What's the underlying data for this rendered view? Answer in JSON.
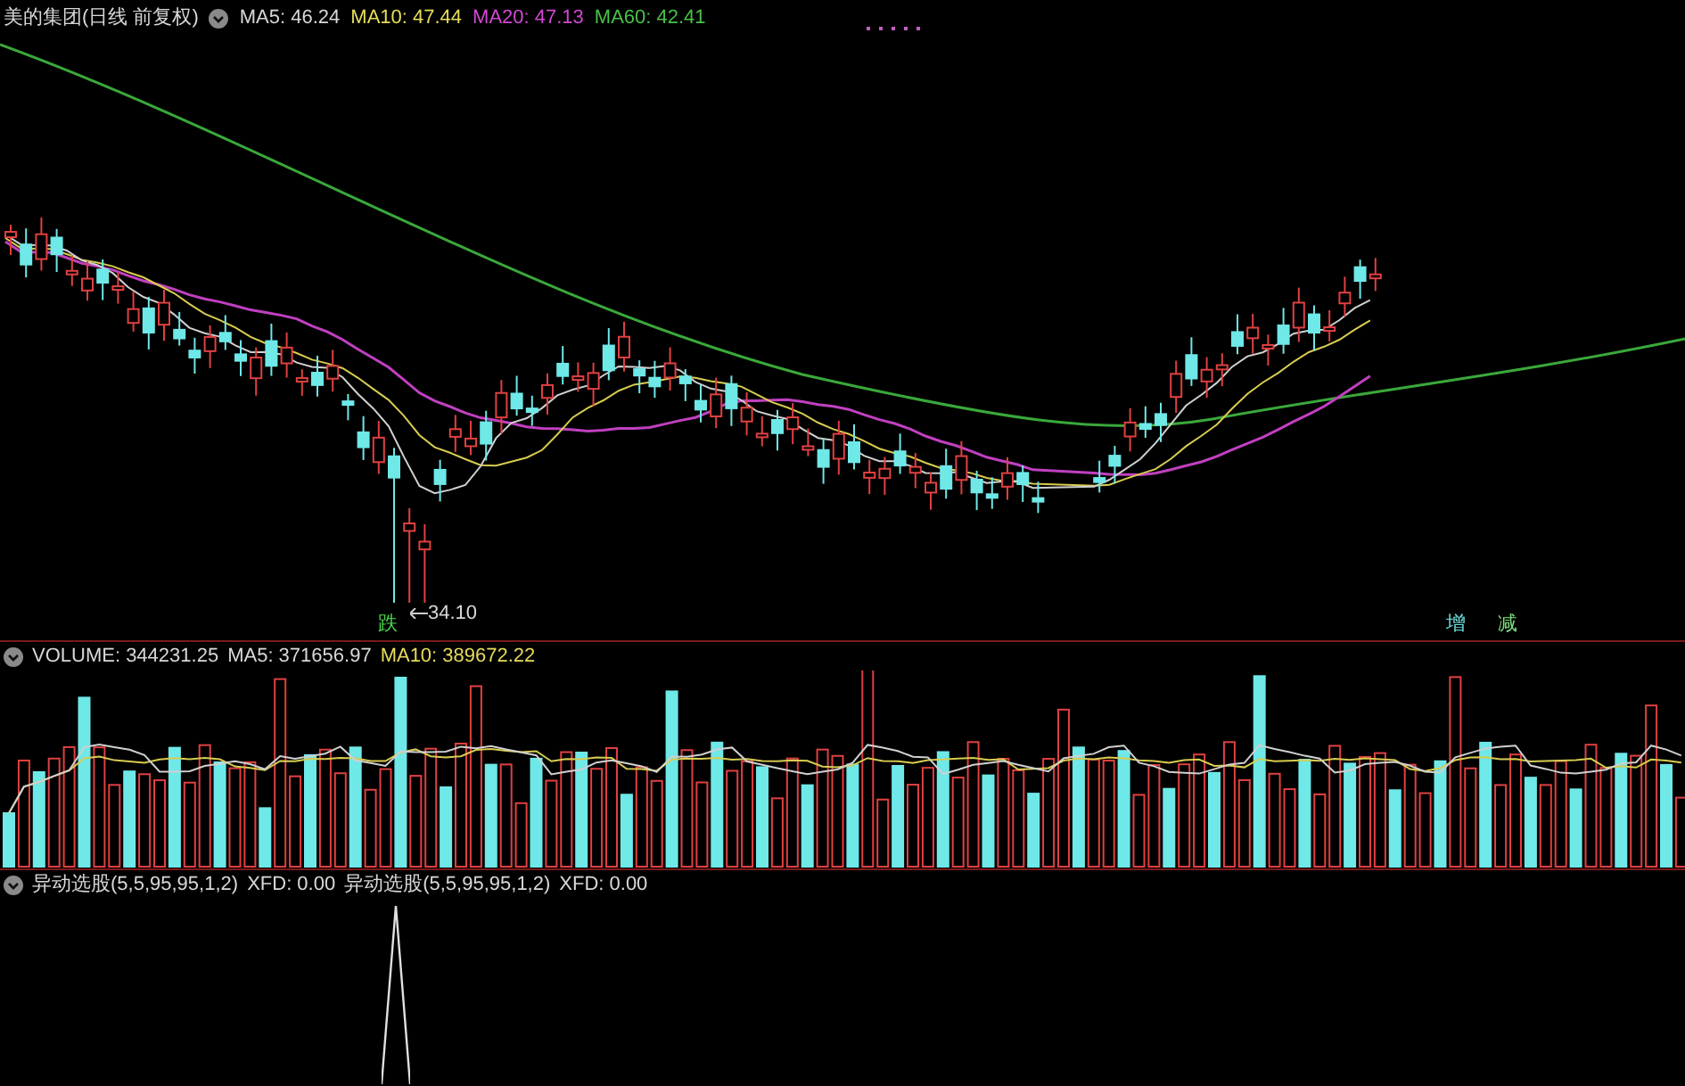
{
  "price_panel": {
    "title": "美的集团(日线 前复权)",
    "legend": [
      {
        "label": "MA5: 46.24",
        "color": "#d8d8d8"
      },
      {
        "label": "MA10: 47.44",
        "color": "#e6dc5a"
      },
      {
        "label": "MA20: 47.13",
        "color": "#d048d0"
      },
      {
        "label": "MA60: 42.41",
        "color": "#48c048"
      }
    ],
    "low_label": "34.10",
    "low_marker": {
      "text": "跌",
      "color": "#4cd84c"
    },
    "right_markers": [
      {
        "text": "增",
        "color": "#6fe0e0"
      },
      {
        "text": "减",
        "color": "#7ee07e"
      }
    ]
  },
  "volume_panel": {
    "legend": [
      {
        "label": "VOLUME: 344231.25",
        "color": "#d8d8d8"
      },
      {
        "label": "MA5: 371656.97",
        "color": "#d8d8d8"
      },
      {
        "label": "MA10: 389672.22",
        "color": "#e6dc5a"
      }
    ]
  },
  "indicator_panel": {
    "legend": [
      {
        "label": "异动选股(5,5,95,95,1,2)",
        "color": "#d8d8d8"
      },
      {
        "label": "XFD: 0.00",
        "color": "#d8d8d8"
      },
      {
        "label": "异动选股(5,5,95,95,1,2)",
        "color": "#d8d8d8"
      },
      {
        "label": "XFD: 0.00",
        "color": "#d8d8d8"
      }
    ]
  }
}
